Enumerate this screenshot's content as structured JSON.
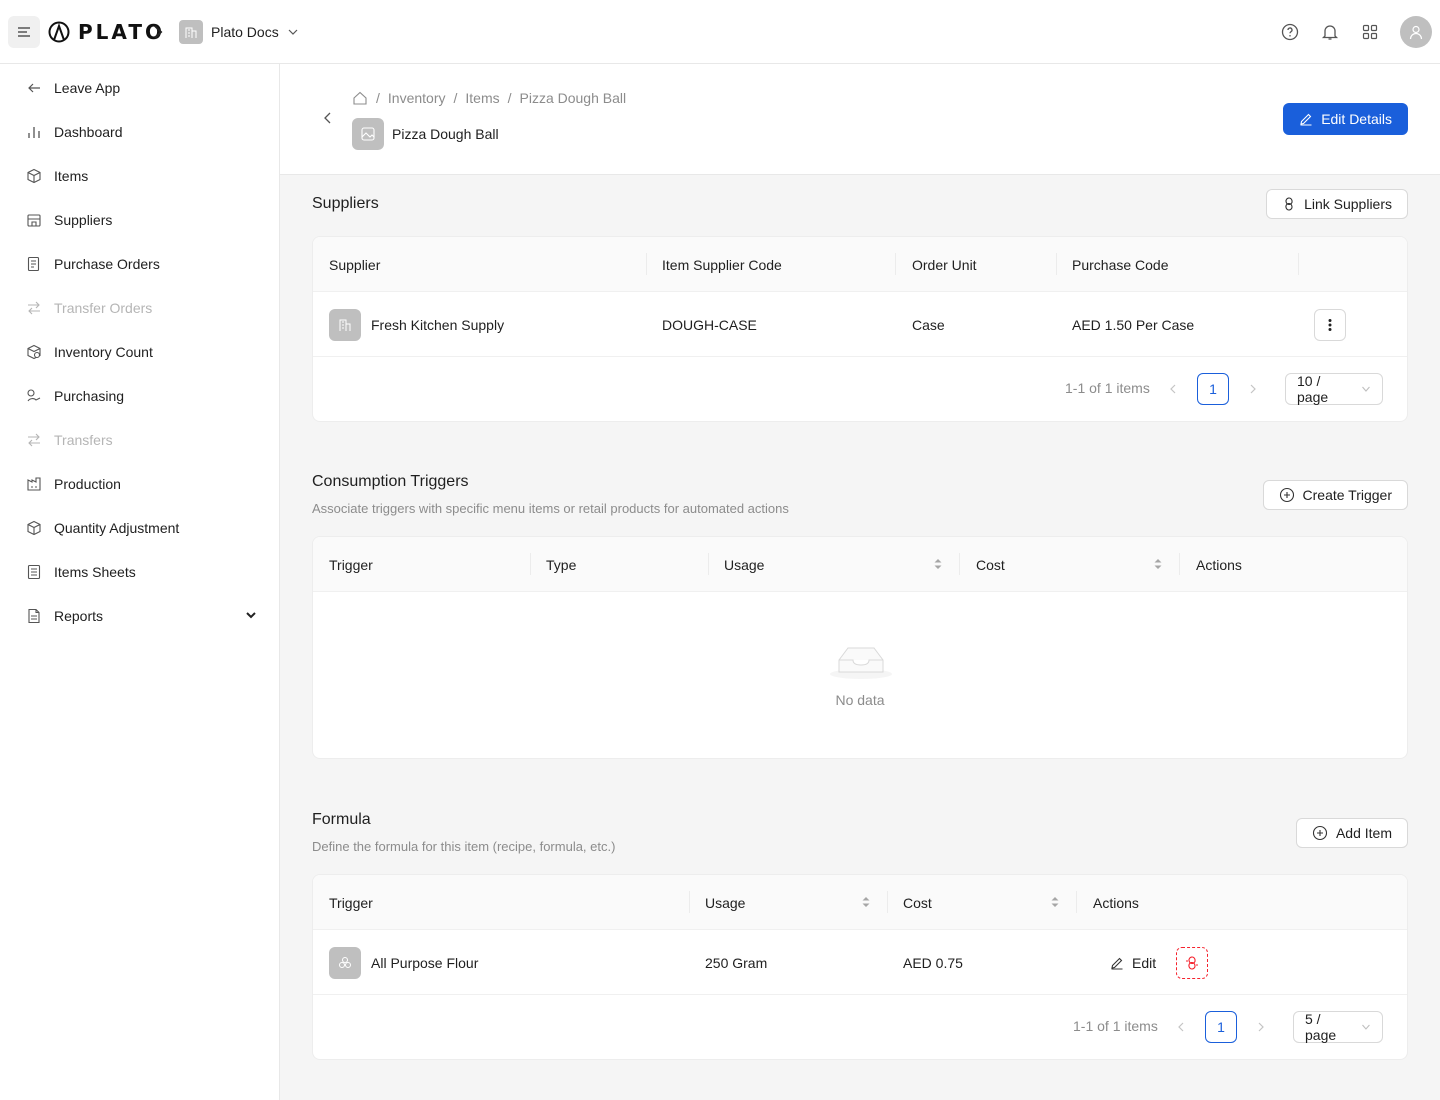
{
  "topbar": {
    "logo_text": "PLATO",
    "org_name": "Plato Docs",
    "icons": [
      "menu-icon",
      "help-icon",
      "bell-icon",
      "apps-icon",
      "user-icon"
    ]
  },
  "sidebar": {
    "items": [
      {
        "label": "Leave App",
        "icon": "arrow-left-icon",
        "disabled": false
      },
      {
        "label": "Dashboard",
        "icon": "bar-chart-icon",
        "disabled": false
      },
      {
        "label": "Items",
        "icon": "box-icon",
        "disabled": false
      },
      {
        "label": "Suppliers",
        "icon": "store-icon",
        "disabled": false
      },
      {
        "label": "Purchase Orders",
        "icon": "order-icon",
        "disabled": false
      },
      {
        "label": "Transfer Orders",
        "icon": "transfer-icon",
        "disabled": true
      },
      {
        "label": "Inventory Count",
        "icon": "count-icon",
        "disabled": false
      },
      {
        "label": "Purchasing",
        "icon": "purchasing-icon",
        "disabled": false
      },
      {
        "label": "Transfers",
        "icon": "transfer-icon",
        "disabled": true
      },
      {
        "label": "Production",
        "icon": "factory-icon",
        "disabled": false
      },
      {
        "label": "Quantity Adjustment",
        "icon": "adjust-icon",
        "disabled": false
      },
      {
        "label": "Items Sheets",
        "icon": "sheet-icon",
        "disabled": false
      },
      {
        "label": "Reports",
        "icon": "report-icon",
        "disabled": false
      }
    ]
  },
  "header": {
    "breadcrumb": [
      "Inventory",
      "Items",
      "Pizza Dough Ball"
    ],
    "sep": "/",
    "title": "Pizza Dough Ball",
    "edit_button": "Edit Details"
  },
  "suppliers": {
    "title": "Suppliers",
    "link_button": "Link Suppliers",
    "columns": [
      "Supplier",
      "Item Supplier Code",
      "Order Unit",
      "Purchase Code"
    ],
    "rows": [
      {
        "supplier": "Fresh Kitchen Supply",
        "code": "DOUGH-CASE",
        "unit": "Case",
        "purchase": "AED 1.50 Per Case"
      }
    ],
    "pagination": {
      "total": "1-1 of 1 items",
      "page": "1",
      "size": "10 / page"
    }
  },
  "triggers": {
    "title": "Consumption Triggers",
    "description": "Associate triggers with specific menu items or retail products for automated actions",
    "create_button": "Create Trigger",
    "columns": [
      "Trigger",
      "Type",
      "Usage",
      "Cost",
      "Actions"
    ],
    "empty_text": "No data"
  },
  "formula": {
    "title": "Formula",
    "description": "Define the formula for this item (recipe, formula, etc.)",
    "add_button": "Add Item",
    "columns": [
      "Trigger",
      "Usage",
      "Cost",
      "Actions"
    ],
    "rows": [
      {
        "name": "All Purpose Flour",
        "usage": "250 Gram",
        "cost": "AED 0.75",
        "edit": "Edit"
      }
    ],
    "pagination": {
      "total": "1-1 of 1 items",
      "page": "1",
      "size": "5 / page"
    }
  },
  "colors": {
    "primary": "#1a5fdb",
    "danger": "#f5222d",
    "muted": "#8c8c8c"
  }
}
